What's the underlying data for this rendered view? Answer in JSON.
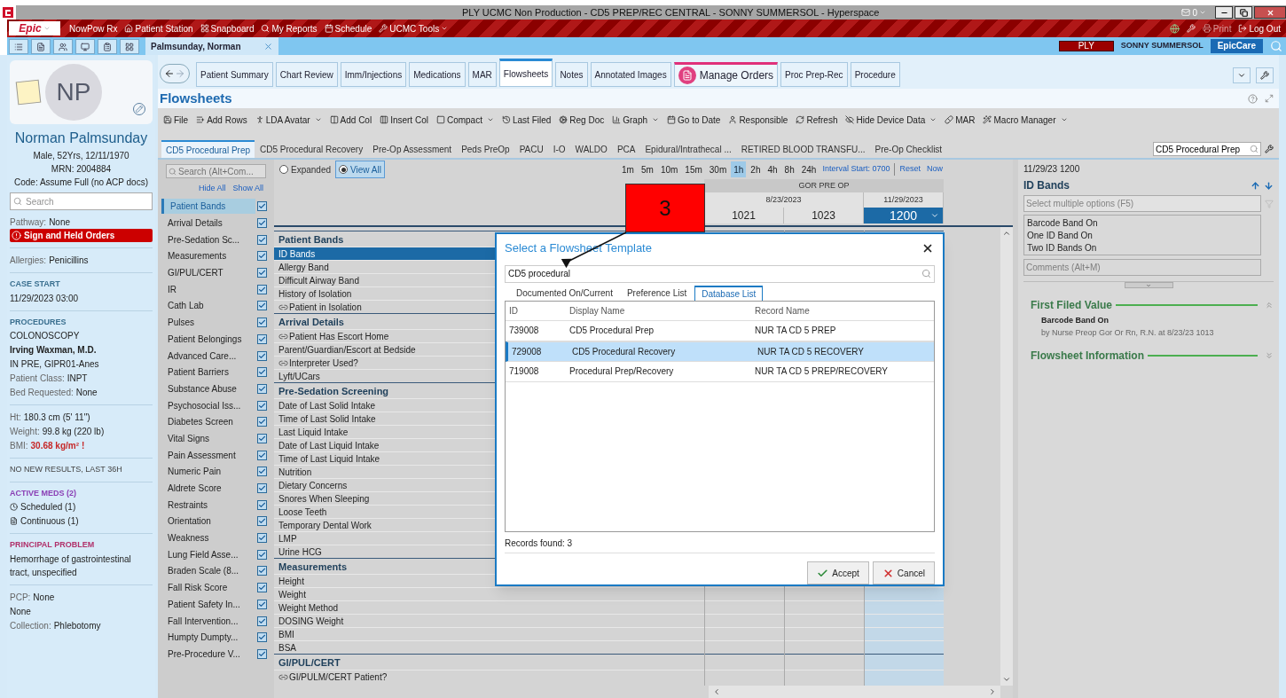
{
  "window": {
    "title": "PLY UCMC Non Production - CD5 PREP/REC CENTRAL - SONNY SUMMERSOL - Hyperspace",
    "mail_count": "0"
  },
  "menu_bar": {
    "logo": "Epic",
    "items": [
      {
        "label": "NowPow Rx",
        "menu": false
      },
      {
        "label": "Patient Station",
        "menu": false
      },
      {
        "label": "Snapboard",
        "menu": false
      },
      {
        "label": "My Reports",
        "menu": false
      },
      {
        "label": "Schedule",
        "menu": false
      },
      {
        "label": "UCMC Tools",
        "menu": true
      }
    ],
    "right_items": [
      {
        "label": "Print",
        "disabled": true
      },
      {
        "label": "Log Out",
        "disabled": false
      }
    ]
  },
  "workspace_bar": {
    "patient_tab": "Palmsunday, Norman",
    "environment": "PLY",
    "user": "SONNY SUMMERSOL",
    "app": "EpicCare"
  },
  "patient": {
    "initials": "NP",
    "name": "Norman Palmsunday",
    "demographics": "Male, 52Yrs, 12/11/1970",
    "mrn": "MRN: 2004884",
    "code": "Code: Assume Full (no ACP docs)",
    "search_placeholder": "Search",
    "pathway_label": "Pathway:",
    "pathway": "None",
    "alert": "Sign and Held Orders",
    "sections": [
      {
        "lines": [
          {
            "kind": "pair",
            "label": "Allergies:",
            "value": "Penicillins"
          }
        ]
      },
      {
        "heading": "CASE START",
        "color": "#3a6f8f",
        "lines": [
          {
            "kind": "text",
            "value": "11/29/2023 03:00"
          }
        ]
      },
      {
        "heading": "PROCEDURES",
        "color": "#3a6f8f",
        "lines": [
          {
            "kind": "text",
            "value": "COLONOSCOPY"
          },
          {
            "kind": "bold",
            "value": "Irving Waxman, M.D."
          },
          {
            "kind": "text",
            "value": "IN PRE, GIPR01-Anes"
          },
          {
            "kind": "pair",
            "label": "Patient Class:",
            "value": "INPT"
          },
          {
            "kind": "pair",
            "label": "Bed Requested:",
            "value": "None"
          }
        ]
      },
      {
        "lines": [
          {
            "kind": "pair",
            "label": "Ht:",
            "value": "180.3 cm (5' 11\")"
          },
          {
            "kind": "pair",
            "label": "Weight:",
            "value": "99.8 kg (220 lb)"
          },
          {
            "kind": "alert",
            "label": "BMI:",
            "value": "30.68 kg/m²",
            "flag": "!"
          }
        ]
      },
      {
        "lines": [
          {
            "kind": "caption",
            "value": "NO NEW RESULTS, LAST 36H"
          }
        ]
      },
      {
        "heading": "ACTIVE MEDS (2)",
        "color": "#8a3fb5",
        "lines": [
          {
            "kind": "clock",
            "value": "Scheduled (1)"
          },
          {
            "kind": "doc",
            "value": "Continuous (1)"
          }
        ]
      },
      {
        "heading": "PRINCIPAL PROBLEM",
        "color": "#b0306a",
        "lines": [
          {
            "kind": "text",
            "value": "Hemorrhage of gastrointestinal tract, unspecified"
          }
        ]
      },
      {
        "lines": [
          {
            "kind": "pair",
            "label": "PCP:",
            "value": "None"
          },
          {
            "kind": "text",
            "value": "None"
          },
          {
            "kind": "pair",
            "label": "Collection:",
            "value": "Phlebotomy"
          }
        ]
      }
    ]
  },
  "activity_tabs": [
    {
      "label": "Patient Summary",
      "selected": false,
      "kind": "plain"
    },
    {
      "label": "Chart Review",
      "selected": false,
      "kind": "plain"
    },
    {
      "label": "Imm/Injections",
      "selected": false,
      "kind": "plain"
    },
    {
      "label": "Medications",
      "selected": false,
      "kind": "plain"
    },
    {
      "label": "MAR",
      "selected": false,
      "kind": "plain"
    },
    {
      "label": "Flowsheets",
      "selected": true,
      "kind": "plain"
    },
    {
      "label": "Notes",
      "selected": false,
      "kind": "plain"
    },
    {
      "label": "Annotated Images",
      "selected": false,
      "kind": "plain"
    },
    {
      "label": "Manage Orders",
      "selected": false,
      "kind": "featured"
    },
    {
      "label": "Proc Prep-Rec",
      "selected": false,
      "kind": "plain"
    },
    {
      "label": "Procedure",
      "selected": false,
      "kind": "plain"
    }
  ],
  "flowsheet": {
    "title": "Flowsheets",
    "toolbar": [
      {
        "label": "File",
        "menu": false
      },
      {
        "label": "Add Rows",
        "menu": false
      },
      {
        "label": "LDA Avatar",
        "menu": true
      },
      {
        "label": "Add Col",
        "menu": false
      },
      {
        "label": "Insert Col",
        "menu": false
      },
      {
        "label": "Compact",
        "menu": true
      },
      {
        "label": "Last Filed",
        "menu": false
      },
      {
        "label": "Reg Doc",
        "menu": false
      },
      {
        "label": "Graph",
        "menu": true
      },
      {
        "label": "Go to Date",
        "menu": false
      },
      {
        "label": "Responsible",
        "menu": false
      },
      {
        "label": "Refresh",
        "menu": false
      },
      {
        "label": "Hide Device Data",
        "menu": true
      },
      {
        "label": "MAR",
        "menu": false
      },
      {
        "label": "Macro Manager",
        "menu": true
      }
    ],
    "templates": [
      {
        "label": "CD5 Procedural Prep",
        "selected": true
      },
      {
        "label": "CD5 Procedural Recovery",
        "selected": false
      },
      {
        "label": "Pre-Op Assessment",
        "selected": false
      },
      {
        "label": "Peds PreOp",
        "selected": false
      },
      {
        "label": "PACU",
        "selected": false
      },
      {
        "label": "I-O",
        "selected": false
      },
      {
        "label": "WALDO",
        "selected": false
      },
      {
        "label": "PCA",
        "selected": false
      },
      {
        "label": "Epidural/Intrathecal ...",
        "selected": false
      },
      {
        "label": "RETIRED BLOOD TRANSFU...",
        "selected": false
      },
      {
        "label": "Pre-Op Checklist",
        "selected": false
      }
    ],
    "template_search": "CD5 Procedural Prep",
    "nav": {
      "search_placeholder": "Search (Alt+Com...",
      "hide_all": "Hide All",
      "show_all": "Show All",
      "items": [
        {
          "label": "Patient Bands",
          "selected": true,
          "checked": true
        },
        {
          "label": "Arrival Details",
          "selected": false,
          "checked": true
        },
        {
          "label": "Pre-Sedation Sc...",
          "selected": false,
          "checked": true
        },
        {
          "label": "Measurements",
          "selected": false,
          "checked": true
        },
        {
          "label": "GI/PUL/CERT",
          "selected": false,
          "checked": true
        },
        {
          "label": "IR",
          "selected": false,
          "checked": true
        },
        {
          "label": "Cath Lab",
          "selected": false,
          "checked": true
        },
        {
          "label": "Pulses",
          "selected": false,
          "checked": true
        },
        {
          "label": "Patient Belongings",
          "selected": false,
          "checked": true
        },
        {
          "label": "Advanced Care...",
          "selected": false,
          "checked": true
        },
        {
          "label": "Patient Barriers",
          "selected": false,
          "checked": true
        },
        {
          "label": "Substance Abuse",
          "selected": false,
          "checked": true
        },
        {
          "label": "Psychosocial Iss...",
          "selected": false,
          "checked": true
        },
        {
          "label": "Diabetes Screen",
          "selected": false,
          "checked": true
        },
        {
          "label": "Vital Signs",
          "selected": false,
          "checked": true
        },
        {
          "label": "Pain Assessment",
          "selected": false,
          "checked": true
        },
        {
          "label": "Numeric Pain",
          "selected": false,
          "checked": true
        },
        {
          "label": "Aldrete Score",
          "selected": false,
          "checked": true
        },
        {
          "label": "Restraints",
          "selected": false,
          "checked": true
        },
        {
          "label": "Orientation",
          "selected": false,
          "checked": true
        },
        {
          "label": "Weakness",
          "selected": false,
          "checked": true
        },
        {
          "label": "Lung Field Asse...",
          "selected": false,
          "checked": true
        },
        {
          "label": "Braden Scale (8...",
          "selected": false,
          "checked": true
        },
        {
          "label": "Fall Risk Score",
          "selected": false,
          "checked": true
        },
        {
          "label": "Patient Safety In...",
          "selected": false,
          "checked": true
        },
        {
          "label": "Fall Intervention...",
          "selected": false,
          "checked": true
        },
        {
          "label": "Humpty Dumpty...",
          "selected": false,
          "checked": true
        },
        {
          "label": "Pre-Procedure V...",
          "selected": false,
          "checked": true
        }
      ]
    },
    "view_options": [
      {
        "label": "Expanded",
        "selected": false
      },
      {
        "label": "View All",
        "selected": true
      }
    ],
    "intervals": [
      {
        "label": "1m",
        "selected": false
      },
      {
        "label": "5m",
        "selected": false
      },
      {
        "label": "10m",
        "selected": false
      },
      {
        "label": "15m",
        "selected": false
      },
      {
        "label": "30m",
        "selected": false
      },
      {
        "label": "1h",
        "selected": true
      },
      {
        "label": "2h",
        "selected": false
      },
      {
        "label": "4h",
        "selected": false
      },
      {
        "label": "8h",
        "selected": false
      },
      {
        "label": "24h",
        "selected": false
      }
    ],
    "interval_start": "Interval Start: 0700",
    "reset": "Reset",
    "now": "Now",
    "column_group": "GOR PRE OP",
    "columns": [
      {
        "date": "8/23/2023",
        "time": "1021",
        "selected": false
      },
      {
        "time": "1023",
        "selected": false
      },
      {
        "date": "11/29/2023",
        "time": "1200",
        "selected": true
      }
    ],
    "sections": [
      {
        "title": "Patient Bands",
        "rows": [
          {
            "label": "ID Bands",
            "selected": true,
            "linked": false
          },
          {
            "label": "Allergy Band",
            "selected": false,
            "linked": false
          },
          {
            "label": "Difficult Airway Band",
            "selected": false,
            "linked": false
          },
          {
            "label": "History of Isolation",
            "selected": false,
            "linked": false
          },
          {
            "label": "Patient in Isolation",
            "selected": false,
            "linked": true
          }
        ]
      },
      {
        "title": "Arrival Details",
        "rows": [
          {
            "label": "Patient Has Escort Home",
            "selected": false,
            "linked": true
          },
          {
            "label": "Parent/Guardian/Escort at Bedside",
            "selected": false,
            "linked": false
          },
          {
            "label": "Interpreter Used?",
            "selected": false,
            "linked": true
          },
          {
            "label": "Lyft/UCars",
            "selected": false,
            "linked": false
          }
        ]
      },
      {
        "title": "Pre-Sedation Screening",
        "rows": [
          {
            "label": "Date of Last Solid Intake",
            "selected": false,
            "linked": false
          },
          {
            "label": "Time of Last Solid Intake",
            "selected": false,
            "linked": false
          },
          {
            "label": "Last Liquid Intake",
            "selected": false,
            "linked": false
          },
          {
            "label": "Date of Last Liquid Intake",
            "selected": false,
            "linked": false
          },
          {
            "label": "Time of Last Liquid Intake",
            "selected": false,
            "linked": false
          },
          {
            "label": "Nutrition",
            "selected": false,
            "linked": false
          },
          {
            "label": "Dietary Concerns",
            "selected": false,
            "linked": false
          },
          {
            "label": "Snores When Sleeping",
            "selected": false,
            "linked": false
          },
          {
            "label": "Loose Teeth",
            "selected": false,
            "linked": false
          },
          {
            "label": "Temporary Dental Work",
            "selected": false,
            "linked": false
          },
          {
            "label": "LMP",
            "selected": false,
            "linked": false
          },
          {
            "label": "Urine HCG",
            "selected": false,
            "linked": false
          }
        ]
      },
      {
        "title": "Measurements",
        "rows": [
          {
            "label": "Height",
            "selected": false,
            "linked": false
          },
          {
            "label": "Weight",
            "selected": false,
            "linked": false
          },
          {
            "label": "Weight Method",
            "selected": false,
            "linked": false
          },
          {
            "label": "DOSING  Weight",
            "selected": false,
            "linked": false
          },
          {
            "label": "BMI",
            "selected": false,
            "linked": false
          },
          {
            "label": "BSA",
            "selected": false,
            "linked": false
          }
        ]
      },
      {
        "title": "GI/PUL/CERT",
        "rows": [
          {
            "label": "GI/PULM/CERT Patient?",
            "selected": false,
            "linked": true
          }
        ]
      }
    ]
  },
  "detail_panel": {
    "timestamp": "11/29/23 1200",
    "title": "ID Bands",
    "select_placeholder": "Select multiple options (F5)",
    "options": [
      "Barcode Band On",
      "One ID Band On",
      "Two ID Bands On"
    ],
    "comments_placeholder": "Comments (Alt+M)",
    "sections": [
      {
        "title": "First Filed Value",
        "expanded": true,
        "value": "Barcode Band On",
        "detail": "by Nurse Preop Gor Or Rn, R.N. at 8/23/23 1013"
      },
      {
        "title": "Flowsheet Information",
        "expanded": false
      }
    ]
  },
  "dialog": {
    "title": "Select a Flowsheet Template",
    "search": "CD5 procedural",
    "tabs": [
      {
        "label": "Documented On/Current",
        "selected": false
      },
      {
        "label": "Preference List",
        "selected": false
      },
      {
        "label": "Database List",
        "selected": true
      }
    ],
    "columns": [
      "ID",
      "Display Name",
      "Record Name"
    ],
    "rows": [
      {
        "cells": [
          "739008",
          "CD5 Procedural Prep",
          "NUR TA CD 5 PREP"
        ],
        "selected": false
      },
      {
        "cells": [
          "729008",
          "CD5 Procedural Recovery",
          "NUR TA CD 5 RECOVERY"
        ],
        "selected": true
      },
      {
        "cells": [
          "719008",
          "Procedural Prep/Recovery",
          "NUR TA CD 5 PREP/RECOVERY"
        ],
        "selected": false
      }
    ],
    "records_found": "Records found: 3",
    "buttons": [
      {
        "label": "Accept",
        "kind": "accept"
      },
      {
        "label": "Cancel",
        "kind": "cancel"
      }
    ]
  },
  "callout": {
    "label": "3"
  }
}
